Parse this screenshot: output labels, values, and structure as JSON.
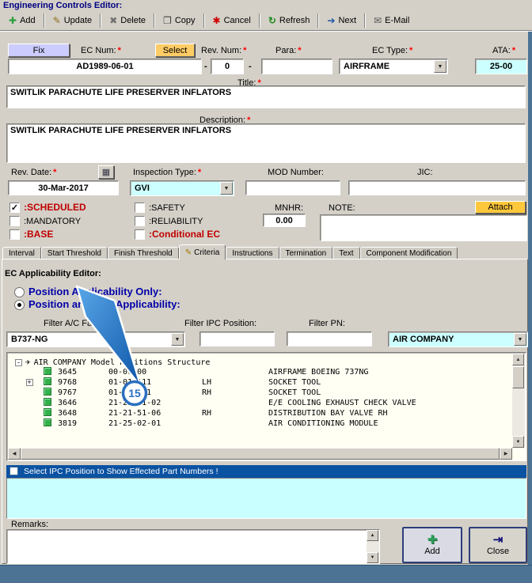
{
  "window_title": "Engineering Controls Editor:",
  "toolbar": {
    "items": [
      {
        "name": "add",
        "label": "Add"
      },
      {
        "name": "update",
        "label": "Update"
      },
      {
        "name": "delete",
        "label": "Delete"
      },
      {
        "name": "copy",
        "label": "Copy"
      },
      {
        "name": "cancel",
        "label": "Cancel"
      },
      {
        "name": "refresh",
        "label": "Refresh"
      },
      {
        "name": "next",
        "label": "Next"
      },
      {
        "name": "email",
        "label": "E-Mail"
      }
    ]
  },
  "icons": {
    "add": "✚",
    "update": "✎",
    "delete": "✖",
    "copy": "❐",
    "cancel": "✱",
    "refresh": "↻",
    "next": "➔",
    "email": "✉",
    "calendar": "▦",
    "dropdown_arrow": "▼",
    "checkmark": "✓",
    "up_arrow": "▲",
    "down_arrow": "▼",
    "left_arrow": "◀",
    "right_arrow": "▶",
    "airplane": "✈",
    "collapse": "-",
    "expand": "+",
    "pencil": "✎",
    "plus_large": "✚",
    "close_glyph": "⇥"
  },
  "form": {
    "required_marker": "*",
    "fix_button": "Fix",
    "select_button": "Select",
    "attach_button": "Attach",
    "dash": "-",
    "ec_num": {
      "label": "EC Num:",
      "value": "AD1989-06-01"
    },
    "rev_num": {
      "label": "Rev. Num:",
      "value": "0"
    },
    "para": {
      "label": "Para:",
      "value": ""
    },
    "ec_type": {
      "label": "EC Type:",
      "value": "AIRFRAME"
    },
    "ata": {
      "label": "ATA:",
      "value": "25-00"
    },
    "title_field": {
      "label": "Title:",
      "value": "SWITLIK PARACHUTE LIFE PRESERVER INFLATORS"
    },
    "description": {
      "label": "Description:",
      "value": "SWITLIK PARACHUTE LIFE PRESERVER INFLATORS"
    },
    "rev_date": {
      "label": "Rev. Date:",
      "value": "30-Mar-2017"
    },
    "inspection_type": {
      "label": "Inspection Type:",
      "value": "GVI"
    },
    "mod_number": {
      "label": "MOD Number:",
      "value": ""
    },
    "jic": {
      "label": "JIC:",
      "value": ""
    },
    "mnhr": {
      "label": "MNHR:",
      "value": "0.00"
    },
    "note_label": "NOTE:",
    "note_value": "",
    "flags": {
      "scheduled": ":SCHEDULED",
      "safety": ":SAFETY",
      "mandatory": ":MANDATORY",
      "reliability": ":RELIABILITY",
      "base": ":BASE",
      "conditional_ec": ":Conditional EC"
    }
  },
  "tabs": [
    "Interval",
    "Start Threshold",
    "Finish Threshold",
    "Criteria",
    "Instructions",
    "Termination",
    "Text",
    "Component Modification"
  ],
  "active_tab": "Criteria",
  "criteria": {
    "section_title": "EC Applicability Editor:",
    "radio_position_only": "Position Applicability Only:",
    "radio_position_part": "Position and Part Applicability:",
    "filter_family_label": "Filter A/C Family:",
    "filter_family_value": "B737-NG",
    "filter_ipc_label": "Filter IPC Position:",
    "filter_ipc_value": "",
    "filter_pn_label": "Filter PN:",
    "filter_pn_value": "",
    "company_value": "AIR COMPANY",
    "tree_root": "AIR COMPANY   Model Positions Structure",
    "tree_rows": [
      {
        "id": "3645",
        "pos": "00-00-00",
        "side": "",
        "desc": "AIRFRAME BOEING 737NG"
      },
      {
        "id": "9768",
        "pos": "01-01-111",
        "side": "LH",
        "desc": "SOCKET TOOL"
      },
      {
        "id": "9767",
        "pos": "01-01-111",
        "side": "RH",
        "desc": "SOCKET TOOL"
      },
      {
        "id": "3646",
        "pos": "21-21-01-02",
        "side": "",
        "desc": "E/E COOLING EXHAUST CHECK VALVE"
      },
      {
        "id": "3648",
        "pos": "21-21-51-06",
        "side": "RH",
        "desc": "DISTRIBUTION BAY VALVE RH"
      },
      {
        "id": "3819",
        "pos": "21-25-02-01",
        "side": "",
        "desc": "AIR CONDITIONING MODULE"
      }
    ],
    "banner": "Select IPC Position to Show Effected Part Numbers !",
    "remarks_label": "Remarks:",
    "remarks_value": "",
    "add_button": "Add",
    "close_button": "Close"
  },
  "annotation": {
    "number": "15"
  },
  "colors": {
    "window_bg": "#d4d0c8",
    "highlight_field": "#ccffff",
    "required": "#ff0000",
    "flag_red": "#c00000",
    "radio_blue": "#0000a8",
    "banner_bg": "#0a52a2",
    "fix_button_bg": "#ccccff",
    "select_button_bg": "#ffcc66",
    "attach_button_bg": "#ffc83c",
    "tree_bg": "#fffff4",
    "frame_teal": "#4c7394",
    "annotation_blue": "#2a6fc0"
  }
}
